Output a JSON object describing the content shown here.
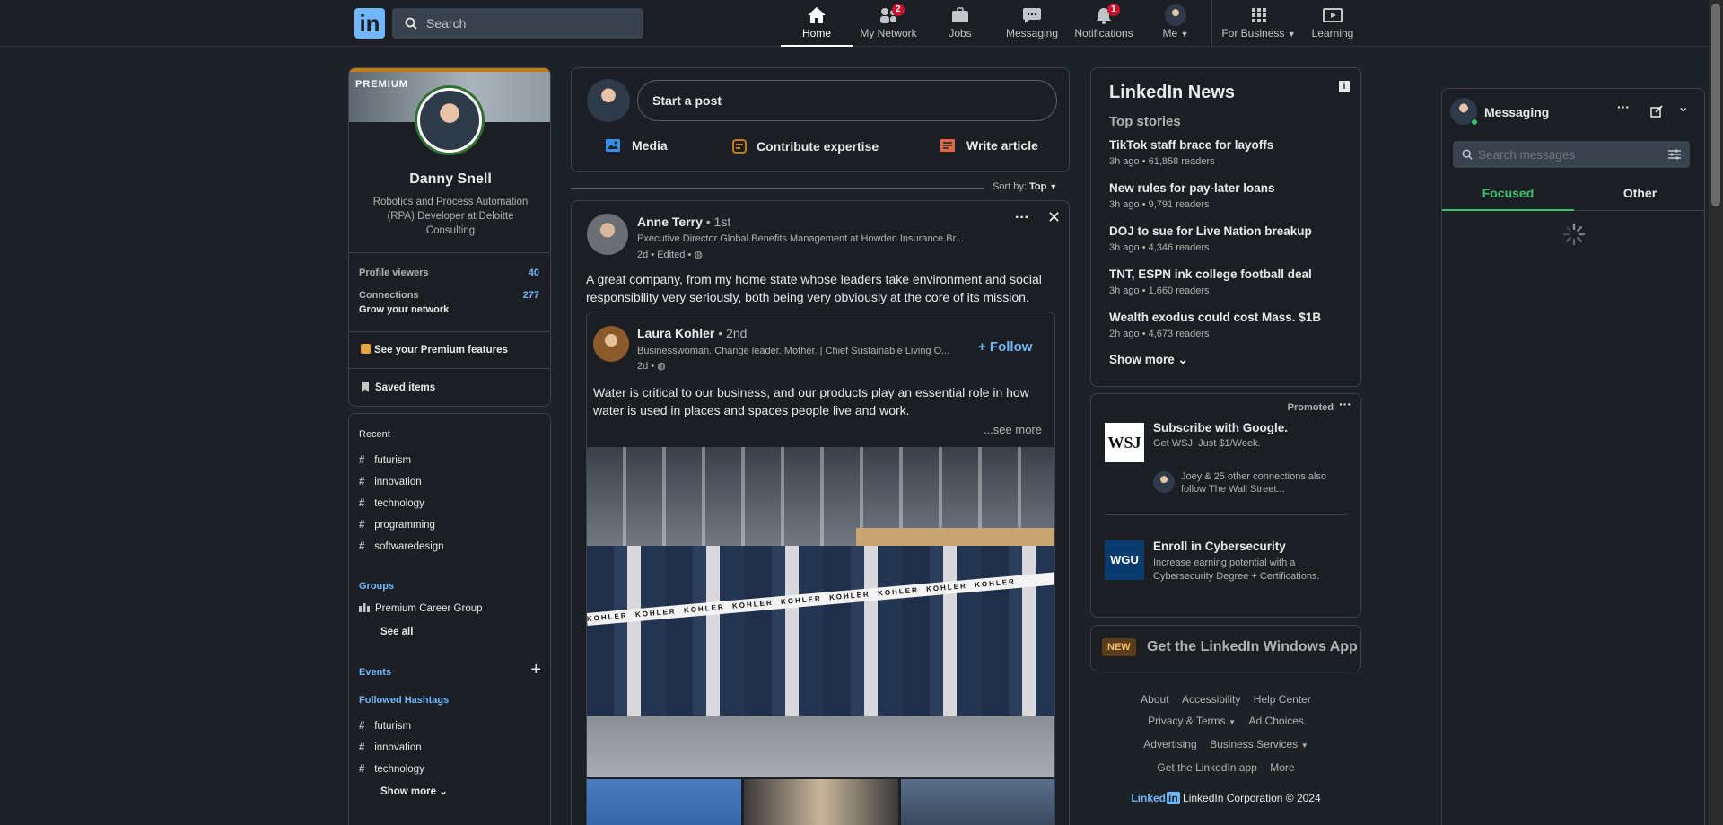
{
  "nav": {
    "logo": "in",
    "search_placeholder": "Search",
    "items": [
      {
        "label": "Home",
        "badge": ""
      },
      {
        "label": "My Network",
        "badge": "2"
      },
      {
        "label": "Jobs",
        "badge": ""
      },
      {
        "label": "Messaging",
        "badge": ""
      },
      {
        "label": "Notifications",
        "badge": "1"
      },
      {
        "label": "Me",
        "badge": ""
      },
      {
        "label": "For Business",
        "badge": ""
      },
      {
        "label": "Learning",
        "badge": ""
      }
    ]
  },
  "profile": {
    "premium_label": "PREMIUM",
    "name": "Danny Snell",
    "headline": "Robotics and Process Automation (RPA) Developer at Deloitte Consulting",
    "viewers_label": "Profile viewers",
    "viewers_count": "40",
    "connections_label": "Connections",
    "connections_count": "277",
    "grow_label": "Grow your network",
    "premium_features": "See your Premium features",
    "saved_items": "Saved items"
  },
  "sidebar": {
    "recent_title": "Recent",
    "recent": [
      "futurism",
      "innovation",
      "technology",
      "programming",
      "softwaredesign"
    ],
    "groups_title": "Groups",
    "group_item": "Premium Career Group",
    "see_all": "See all",
    "events_title": "Events",
    "followed_title": "Followed Hashtags",
    "followed": [
      "futurism",
      "innovation",
      "technology"
    ],
    "show_more": "Show more"
  },
  "composer": {
    "placeholder": "Start a post",
    "media": "Media",
    "expertise": "Contribute expertise",
    "article": "Write article"
  },
  "sort": {
    "label": "Sort by:",
    "value": "Top"
  },
  "post": {
    "author": "Anne Terry",
    "degree": "• 1st",
    "headline": "Executive Director Global Benefits Management at Howden Insurance Br...",
    "meta": "2d • Edited •",
    "text": "A great company, from my home state whose leaders take environment and social responsibility very seriously, both being very obviously at the core of its mission.",
    "shared": {
      "author": "Laura Kohler",
      "degree": "• 2nd",
      "headline": "Businesswoman. Change leader. Mother. | Chief Sustainable Living O...",
      "meta": "2d •",
      "follow": "+ Follow",
      "text": "Water is critical to our business, and our products play an essential role in how water is used in places and spaces people live and work.",
      "see_more": "...see more",
      "ribbon": [
        "KOHLER",
        "KOHLER",
        "KOHLER",
        "KOHLER",
        "KOHLER",
        "KOHLER",
        "KOHLER",
        "KOHLER",
        "KOHLER"
      ]
    }
  },
  "news": {
    "title": "LinkedIn News",
    "subtitle": "Top stories",
    "stories": [
      {
        "headline": "TikTok staff brace for layoffs",
        "meta": "3h ago • 61,858 readers"
      },
      {
        "headline": "New rules for pay-later loans",
        "meta": "3h ago • 9,791 readers"
      },
      {
        "headline": "DOJ to sue for Live Nation breakup",
        "meta": "3h ago • 4,346 readers"
      },
      {
        "headline": "TNT, ESPN ink college football deal",
        "meta": "3h ago • 1,660 readers"
      },
      {
        "headline": "Wealth exodus could cost Mass. $1B",
        "meta": "2h ago • 4,673 readers"
      }
    ],
    "show_more": "Show more"
  },
  "ads": {
    "promoted": "Promoted",
    "ad1_logo": "WSJ",
    "ad1_title": "Subscribe with Google.",
    "ad1_sub": "Get WSJ, Just $1/Week.",
    "ad1_social": "Joey & 25 other connections also follow The Wall Street...",
    "ad2_logo": "WGU",
    "ad2_title": "Enroll in Cybersecurity",
    "ad2_sub": "Increase earning potential with a Cybersecurity Degree + Certifications."
  },
  "app_banner": {
    "badge": "NEW",
    "text": "Get the LinkedIn Windows App"
  },
  "footer": {
    "about": "About",
    "accessibility": "Accessibility",
    "help": "Help Center",
    "privacy": "Privacy & Terms",
    "adchoices": "Ad Choices",
    "advertising": "Advertising",
    "business": "Business Services",
    "getapp": "Get the LinkedIn app",
    "more": "More",
    "brand": "Linked",
    "brand_in": "in",
    "copyright": "LinkedIn Corporation © 2024"
  },
  "messaging": {
    "title": "Messaging",
    "search_placeholder": "Search messages",
    "tab_focused": "Focused",
    "tab_other": "Other"
  },
  "colors": {
    "accent": "#71b7fb",
    "badge": "#cb112d",
    "bg": "#1d2226",
    "card": "#1b1f23",
    "focused": "#38c172"
  }
}
